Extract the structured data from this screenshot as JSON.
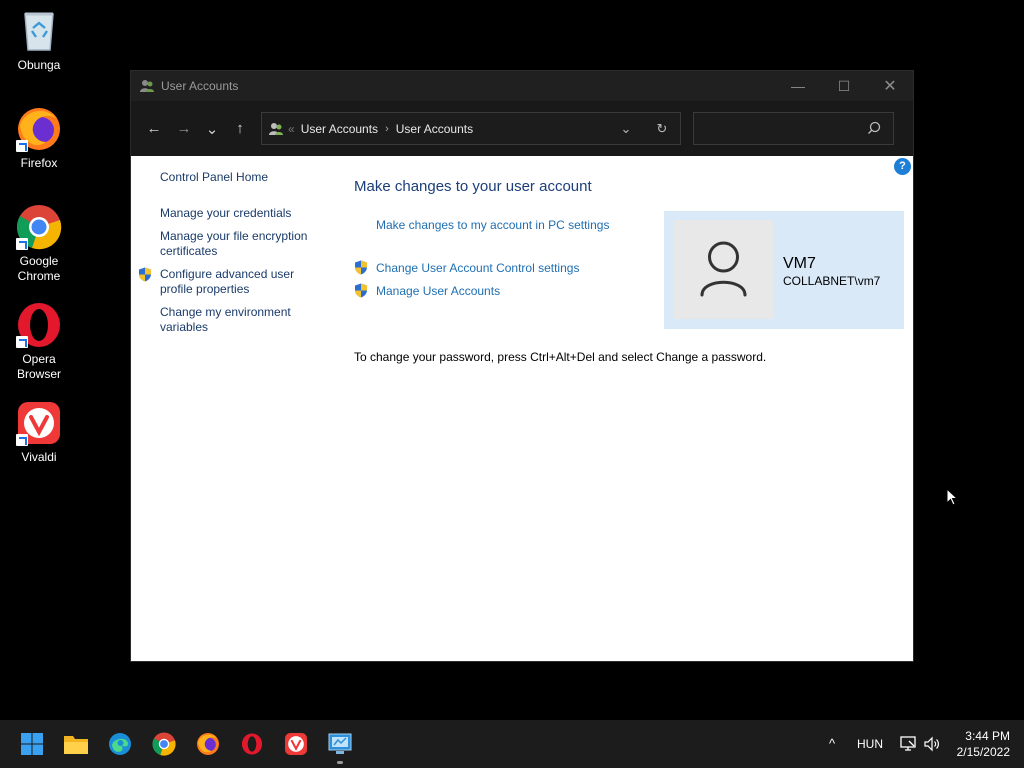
{
  "desktop": {
    "icons": [
      {
        "label": "Obunga",
        "icon": "recycle-bin-icon"
      },
      {
        "label": "Firefox",
        "icon": "firefox-icon"
      },
      {
        "label": "Google Chrome",
        "icon": "chrome-icon"
      },
      {
        "label": "Opera Browser",
        "icon": "opera-icon"
      },
      {
        "label": "Vivaldi",
        "icon": "vivaldi-icon"
      }
    ]
  },
  "window": {
    "title": "User Accounts",
    "controls": {
      "minimize": "—",
      "maximize": "☐",
      "close": "✕"
    },
    "nav": {
      "back": "←",
      "forward": "→",
      "recent": "⌄",
      "up": "↑"
    },
    "address": {
      "overflow": "«",
      "crumbs": [
        "User Accounts",
        "User Accounts"
      ],
      "separator": "›",
      "dropdown": "⌄",
      "refresh": "↻"
    },
    "search": {
      "placeholder": ""
    },
    "help": "?"
  },
  "left_pane": {
    "items": [
      {
        "label": "Control Panel Home",
        "shield": false
      },
      {
        "label": "Manage your credentials",
        "shield": false
      },
      {
        "label": "Manage your file encryption certificates",
        "shield": false
      },
      {
        "label": "Configure advanced user profile properties",
        "shield": true
      },
      {
        "label": "Change my environment variables",
        "shield": false
      }
    ]
  },
  "main": {
    "title": "Make changes to your user account",
    "links": [
      {
        "label": "Make changes to my account in PC settings",
        "shield": false
      },
      {
        "label": "Change User Account Control settings",
        "shield": true
      },
      {
        "label": "Manage User Accounts",
        "shield": true
      }
    ],
    "password_note": "To change your password, press Ctrl+Alt+Del and select Change a password."
  },
  "user": {
    "name": "VM7",
    "domain": "COLLABNET\\vm7"
  },
  "taskbar": {
    "apps": [
      "start-icon",
      "file-explorer-icon",
      "edge-icon",
      "chrome-icon",
      "firefox-icon",
      "opera-icon",
      "vivaldi-icon",
      "control-panel-icon"
    ],
    "tray": {
      "chevron": "^",
      "language": "HUN"
    },
    "clock": {
      "time": "3:44 PM",
      "date": "2/15/2022"
    }
  },
  "colors": {
    "link": "#1f6fb2",
    "heading": "#1b3f7a",
    "card": "#d9e9f8",
    "taskbar": "#1c1c1c"
  }
}
